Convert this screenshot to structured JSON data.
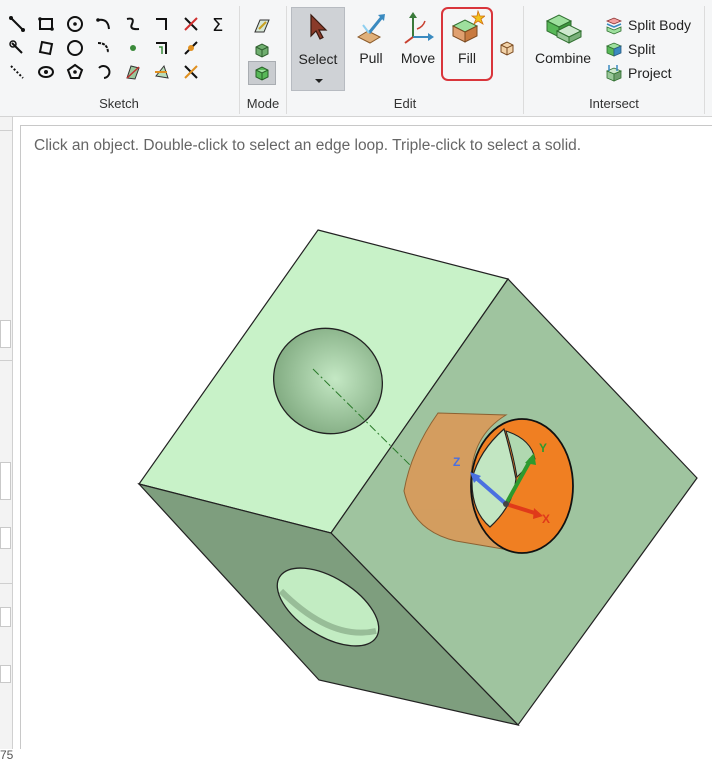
{
  "ribbon": {
    "groups": {
      "sketch": "Sketch",
      "mode": "Mode",
      "edit": "Edit",
      "intersect": "Intersect"
    },
    "edit": {
      "select": "Select",
      "pull": "Pull",
      "move": "Move",
      "fill": "Fill"
    },
    "intersect": {
      "combine": "Combine",
      "split_body": "Split Body",
      "split": "Split",
      "project": "Project"
    },
    "selected_tool": "Select",
    "highlighted_tool": "Fill"
  },
  "left_strip": {
    "partial_value": "75"
  },
  "viewport": {
    "hint": "Click an object. Double-click to select an edge loop. Triple-click to select a solid.",
    "triad": {
      "x": "X",
      "y": "Y",
      "z": "Z"
    }
  },
  "colors": {
    "solid_light": "#c8f2c8",
    "solid_mid": "#9fc49f",
    "solid_dark": "#7e9e7e",
    "selection_orange": "#f08c3c",
    "fill_highlight": "#d9353b"
  }
}
